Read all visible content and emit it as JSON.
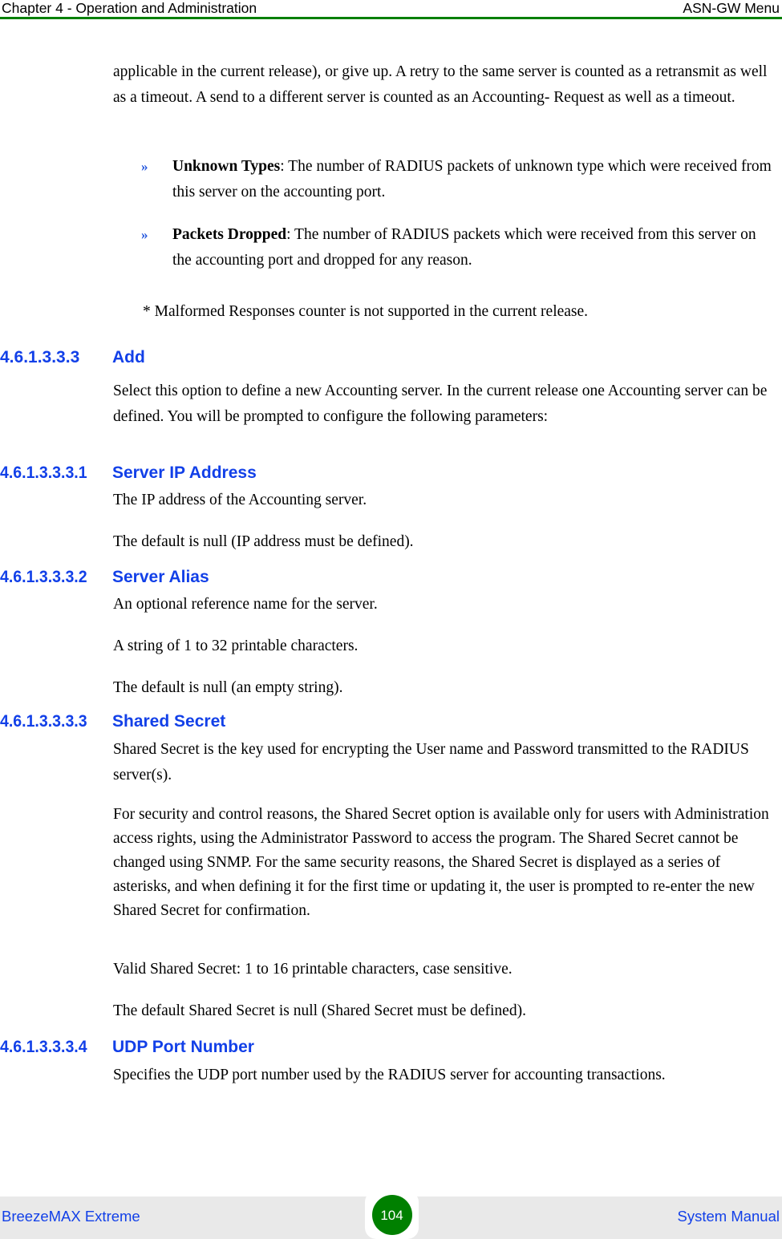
{
  "header": {
    "left": "Chapter 4 - Operation and Administration",
    "right": "ASN-GW Menu",
    "rule_color": "#008000"
  },
  "footer": {
    "left": "BreezeMAX Extreme",
    "right": "System Manual",
    "page_number": "104",
    "badge_color": "#008000",
    "band_color": "#e9e9e9",
    "link_color": "#1240e8"
  },
  "content": {
    "intro_paragraph": "applicable in the current release), or give up. A retry to the same server is counted as a retransmit as well as a timeout. A send to a different server is counted as an Accounting- Request as well as a timeout.",
    "bullets": [
      {
        "marker": "»",
        "term": "Unknown Types",
        "text": ": The number of RADIUS packets of unknown type which were received from this server on the accounting port."
      },
      {
        "marker": "»",
        "term": "Packets Dropped",
        "text": ": The number of RADIUS packets which were received from this server on the accounting port and dropped for any reason."
      }
    ],
    "footnote": "* Malformed Responses counter is not supported in the current release.",
    "sections": [
      {
        "number": "4.6.1.3.3.3",
        "title": "Add",
        "paragraphs": [
          "Select this option to define a new Accounting server. In the current release one Accounting server can be defined. You will be prompted to configure the following parameters:"
        ]
      },
      {
        "number": "4.6.1.3.3.3.1",
        "title": "Server IP Address",
        "paragraphs": [
          "The IP address of the Accounting server.",
          "The default is null (IP address must be defined)."
        ]
      },
      {
        "number": "4.6.1.3.3.3.2",
        "title": "Server Alias",
        "paragraphs": [
          "An optional reference name for the server.",
          "A string of 1 to 32 printable characters.",
          "The default is null (an empty string)."
        ]
      },
      {
        "number": "4.6.1.3.3.3.3",
        "title": "Shared Secret",
        "paragraphs": [
          "Shared Secret is the key used for encrypting the User name and Password transmitted to the RADIUS server(s).",
          "For security and control reasons, the Shared Secret option is available only for users with Administration access rights, using the Administrator Password to access the program. The Shared Secret cannot be changed using SNMP. For the same security reasons, the Shared Secret is displayed as a series of asterisks, and when defining it for the first time or updating it, the user is prompted to re-enter the new Shared Secret for confirmation.",
          "Valid Shared Secret: 1 to 16 printable characters, case sensitive.",
          "The default Shared Secret is null (Shared Secret must be defined)."
        ]
      },
      {
        "number": "4.6.1.3.3.3.4",
        "title": "UDP Port Number",
        "paragraphs": [
          "Specifies the UDP port number used by the RADIUS server for accounting transactions."
        ]
      }
    ]
  }
}
